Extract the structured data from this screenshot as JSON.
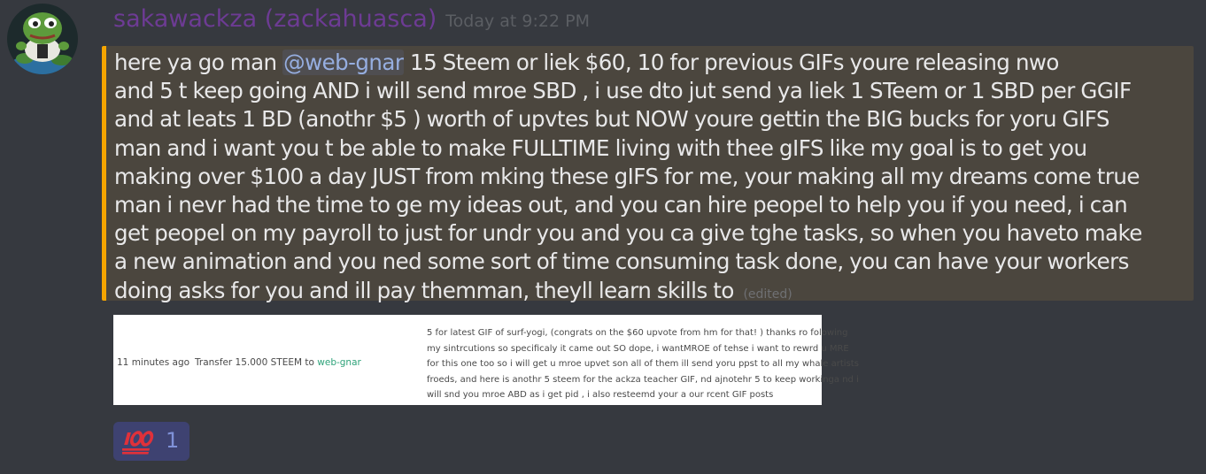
{
  "message": {
    "username": "sakawackza (zackahuasca)",
    "timestamp": "Today at 9:22 PM",
    "mention": "@web-gnar",
    "line_1_before_mention": "here ya go man ",
    "line_1_after_mention": "  15 Steem or liek $60, 10 for previous GIFs youre releasing nwo",
    "lines": [
      "and 5 t keep going AND i will send mroe SBD , i use dto jut send ya liek 1 STeem or 1 SBD per GGIF",
      "and at leats 1 BD (anothr $5 ) worth of upvtes but NOW youre gettin the BIG bucks for yoru GIFS",
      "man and i want you t be able to make FULLTIME living with thee gIFS like my goal is to get you",
      "making over $100 a day JUST from mking these gIFS for me, your making all my dreams come true",
      "man i nevr had the time to ge my ideas out, and you can hire peopel to help you if you need, i can",
      "get peopel on my payroll to just for undr you and you ca give tghe tasks, so when you haveto make",
      "a new animation and you ned some sort of time consuming task done, you can have your workers"
    ],
    "last_line": "doing asks for you and ill pay themman, theyll learn skills to ",
    "edited_label": "(edited)",
    "accent_color": "#f5a500",
    "username_color": "#6d3b94",
    "mention_color": "#96aee0"
  },
  "attachment": {
    "time_ago": "11 minutes ago",
    "transfer_text": "Transfer 15.000 STEEM to ",
    "transfer_recipient": "web-gnar",
    "memo_lines": [
      "5 for latest GIF of surf-yogi, (congrats on the $60 upvote from hm for that! ) thanks ro folowing",
      "my sintrcutions so specificaly it came out SO dope, i wantMROE of tehse i want to rewrd u MRE",
      "for this one too so i will get u mroe upvet son all of them ill send yoru ppst to all my whale artists",
      "froeds, and here is anothr 5 steem for the ackza teacher GIF, nd ajnotehr 5 to keep workinga nd i",
      "will snd you mroe ABD as i get pid , i also resteemd your a our rcent GIF posts"
    ],
    "link_color": "#2fa37a"
  },
  "reaction": {
    "emoji": "hundred-points-icon",
    "count": "1"
  }
}
